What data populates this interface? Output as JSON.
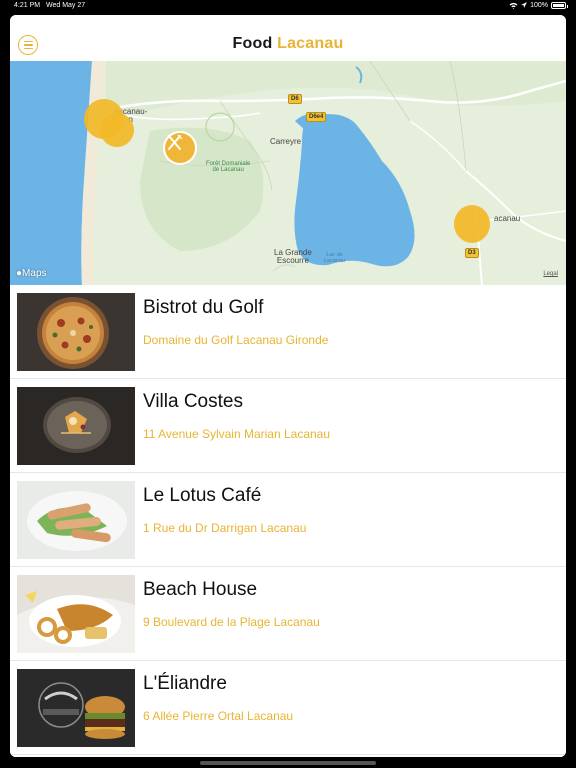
{
  "status_bar": {
    "time": "4:21 PM",
    "date": "Wed May 27",
    "battery": "100%"
  },
  "header": {
    "title_part1": "Food",
    "title_part2": "Lacanau"
  },
  "map": {
    "labels": {
      "lacanau_ocean_top": "nacanau-",
      "lacanau_ocean_bottom": "n",
      "carreyre": "Carreyre",
      "foret_line1": "Forêt Domaniale",
      "foret_line2": "de Lacanau",
      "lacanau_town": "acanau",
      "grande_escourre_line1": "La Grande",
      "grande_escourre_line2": "Escourre",
      "lac_line1": "Lac de",
      "lac_line2": "Lacanau"
    },
    "roads": {
      "d6": "D6",
      "d6e4": "D6e4",
      "d3": "D3"
    },
    "attribution": "Maps",
    "legal": "Legal",
    "accent": "#f0b63a"
  },
  "restaurants": [
    {
      "name": "Bistrot du Golf",
      "address": "Domaine du Golf Lacanau Gironde"
    },
    {
      "name": "Villa Costes",
      "address": "11 Avenue Sylvain Marian Lacanau"
    },
    {
      "name": "Le Lotus Café",
      "address": "1 Rue du Dr Darrigan Lacanau"
    },
    {
      "name": "Beach House",
      "address": "9 Boulevard de la Plage Lacanau"
    },
    {
      "name": "L'Éliandre",
      "address": "6 Allée Pierre Ortal Lacanau"
    }
  ]
}
